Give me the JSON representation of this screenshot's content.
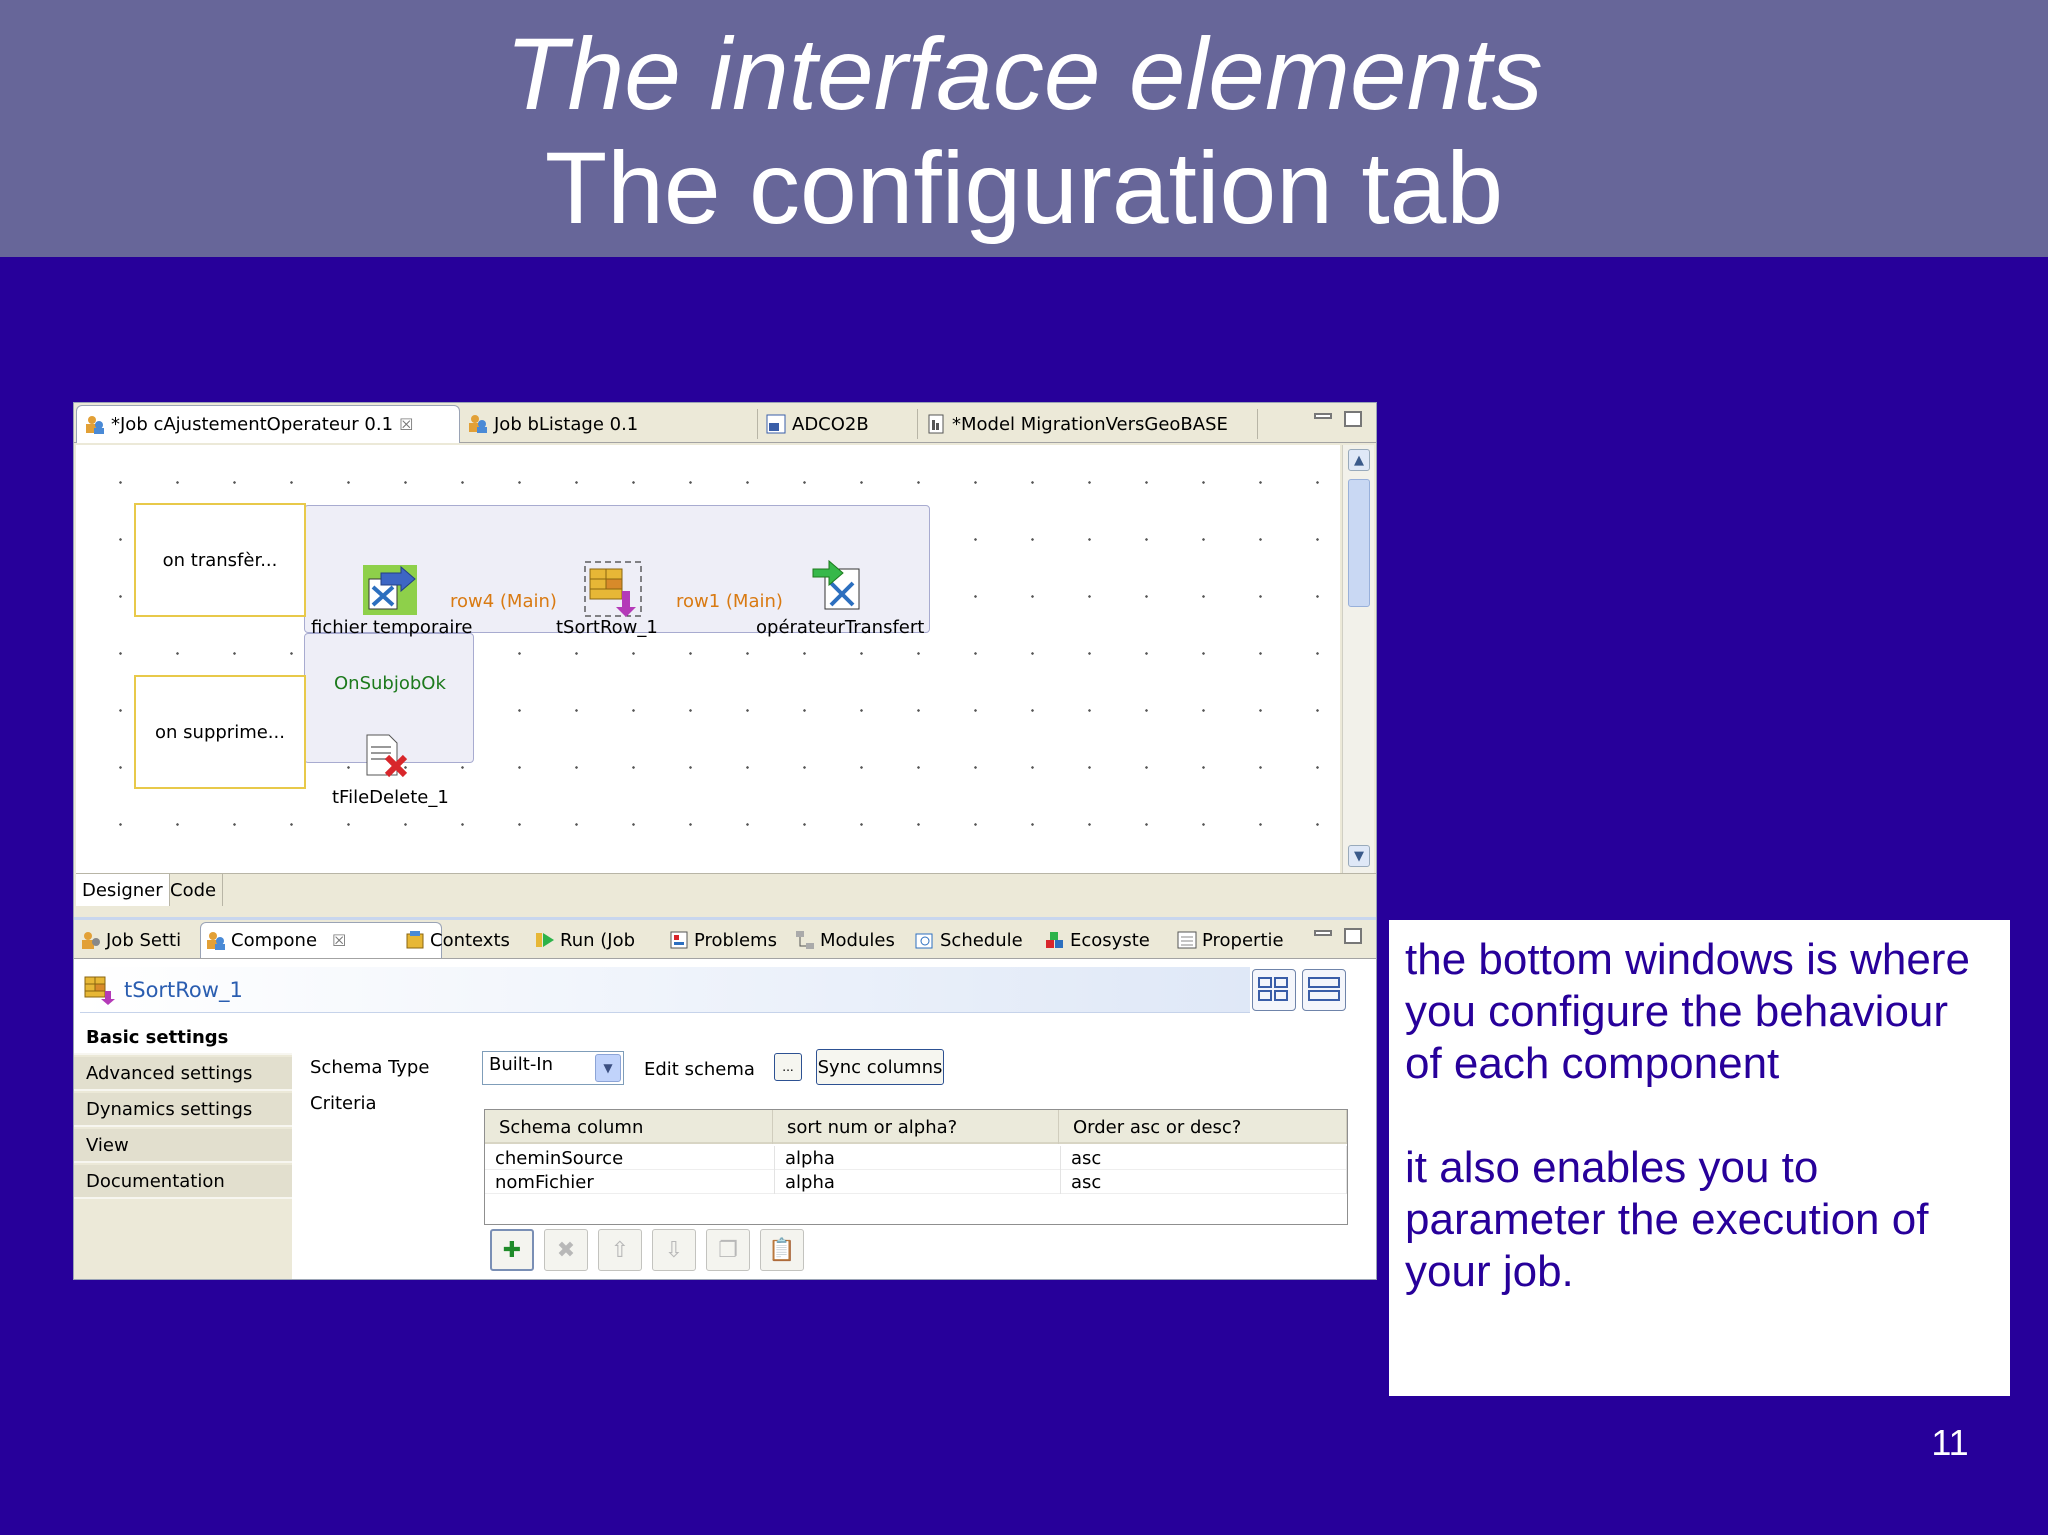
{
  "slide": {
    "title_line1": "The interface elements",
    "title_line2": "The configuration tab",
    "page_number": "11"
  },
  "editor_tabs": [
    {
      "label": "*Job cAjustementOperateur 0.1",
      "icon": "job-icon",
      "closable": true,
      "active": true
    },
    {
      "label": "Job bListage 0.1",
      "icon": "job-icon",
      "active": false
    },
    {
      "label": "ADCO2B",
      "icon": "metadata-icon",
      "active": false
    },
    {
      "label": "*Model MigrationVersGeoBASE",
      "icon": "business-model-icon",
      "active": false
    }
  ],
  "designer": {
    "notes": [
      "on transfèr...",
      "on supprime..."
    ],
    "components": [
      {
        "label": "fichier temporaire",
        "icon": "file-input-icon"
      },
      {
        "label": "tSortRow_1",
        "icon": "sort-row-icon"
      },
      {
        "label": "opérateurTransfert",
        "icon": "file-output-icon"
      },
      {
        "label": "tFileDelete_1",
        "icon": "file-delete-icon"
      }
    ],
    "links": [
      "row4 (Main)",
      "row1 (Main)"
    ],
    "trigger": "OnSubjobOk",
    "tabs": [
      "Designer",
      "Code"
    ]
  },
  "view_tabs": [
    {
      "label": "Job Setti",
      "icon": "job-settings-icon"
    },
    {
      "label": "Compone",
      "icon": "component-icon",
      "closable": true,
      "active": true
    },
    {
      "label": "Contexts",
      "icon": "contexts-icon"
    },
    {
      "label": "Run (Job",
      "icon": "run-icon"
    },
    {
      "label": "Problems",
      "icon": "problems-icon"
    },
    {
      "label": "Modules",
      "icon": "modules-icon"
    },
    {
      "label": "Schedule",
      "icon": "schedule-icon"
    },
    {
      "label": "Ecosyste",
      "icon": "ecosystem-icon"
    },
    {
      "label": "Propertie",
      "icon": "properties-icon"
    }
  ],
  "component_panel": {
    "component_name": "tSortRow_1",
    "sidebar": [
      "Basic settings",
      "Advanced settings",
      "Dynamics settings",
      "View",
      "Documentation"
    ],
    "schema_type_label": "Schema Type",
    "schema_type_value": "Built-In",
    "edit_schema_label": "Edit schema",
    "edit_schema_button": "...",
    "sync_columns_button": "Sync columns",
    "criteria_label": "Criteria",
    "table": {
      "headers": [
        "Schema column",
        "sort num or alpha?",
        "Order asc or desc?"
      ],
      "rows": [
        [
          "cheminSource",
          "alpha",
          "asc"
        ],
        [
          "nomFichier",
          "alpha",
          "asc"
        ]
      ]
    },
    "toolbar": [
      "add-icon",
      "delete-icon",
      "move-up-icon",
      "move-down-icon",
      "copy-icon",
      "paste-icon"
    ]
  },
  "caption": {
    "paragraph1": "the bottom windows is where you configure the behaviour of each component",
    "paragraph2": "it also enables you to parameter the execution of your job."
  },
  "colors": {
    "slide_background": "#27009a",
    "header_band": "#676699",
    "link_main": "#d97a12",
    "trigger_ok": "#1d7a1d",
    "component_name": "#2a5db0"
  }
}
